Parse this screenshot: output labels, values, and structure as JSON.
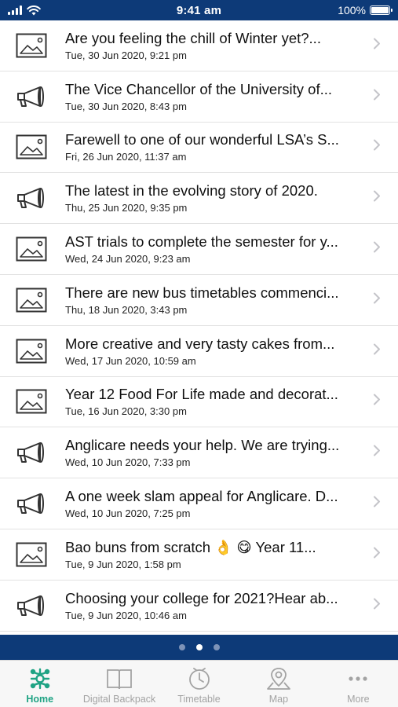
{
  "status_bar": {
    "time": "9:41 am",
    "battery": "100%",
    "battery_level": 1.0
  },
  "news": [
    {
      "icon": "image-icon",
      "title": "Are you feeling the chill of Winter yet?...",
      "date": "Tue, 30 Jun 2020, 9:21 pm"
    },
    {
      "icon": "megaphone-icon",
      "title": "The Vice Chancellor of the University of...",
      "date": "Tue, 30 Jun 2020, 8:43 pm"
    },
    {
      "icon": "image-icon",
      "title": "Farewell to one of our wonderful LSA’s S...",
      "date": "Fri, 26 Jun 2020, 11:37 am"
    },
    {
      "icon": "megaphone-icon",
      "title": "The latest in the evolving story of 2020.",
      "date": "Thu, 25 Jun 2020, 9:35 pm"
    },
    {
      "icon": "image-icon",
      "title": "AST trials to complete the semester for y...",
      "date": "Wed, 24 Jun 2020, 9:23 am"
    },
    {
      "icon": "image-icon",
      "title": "There are new bus timetables commenci...",
      "date": "Thu, 18 Jun 2020, 3:43 pm"
    },
    {
      "icon": "image-icon",
      "title": "More creative and very tasty cakes from...",
      "date": "Wed, 17 Jun 2020, 10:59 am"
    },
    {
      "icon": "image-icon",
      "title": "Year 12 Food For Life made and decorat...",
      "date": "Tue, 16 Jun 2020, 3:30 pm"
    },
    {
      "icon": "megaphone-icon",
      "title": "Anglicare needs your help. We are trying...",
      "date": "Wed, 10 Jun 2020, 7:33 pm"
    },
    {
      "icon": "megaphone-icon",
      "title": "A one week slam appeal for Anglicare. D...",
      "date": "Wed, 10 Jun 2020, 7:25 pm"
    },
    {
      "icon": "image-icon",
      "title": "Bao buns from scratch 👌 😋 Year 11...",
      "date": "Tue, 9 Jun 2020, 1:58 pm"
    },
    {
      "icon": "megaphone-icon",
      "title": "Choosing your college for 2021?Hear ab...",
      "date": "Tue, 9 Jun 2020, 10:46 am"
    }
  ],
  "pager": {
    "count": 3,
    "active_index": 1
  },
  "tabs": [
    {
      "label": "Home",
      "icon": "home-icon",
      "active": true
    },
    {
      "label": "Digital Backpack",
      "icon": "book-icon",
      "active": false
    },
    {
      "label": "Timetable",
      "icon": "clock-icon",
      "active": false
    },
    {
      "label": "Map",
      "icon": "map-pin-icon",
      "active": false
    },
    {
      "label": "More",
      "icon": "more-icon",
      "active": false
    }
  ],
  "colors": {
    "header_blue": "#0d3a78",
    "accent_green": "#1fa384",
    "inactive_gray": "#a3a3a3"
  }
}
